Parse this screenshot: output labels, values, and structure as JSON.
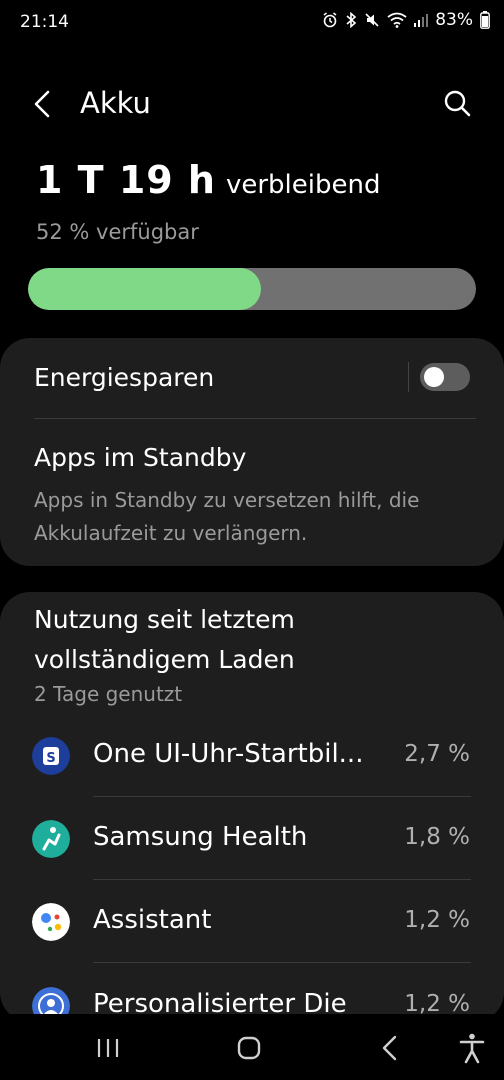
{
  "status_bar": {
    "time": "21:14",
    "battery_percent": "83%",
    "icons": [
      "alarm-icon",
      "bluetooth-icon",
      "mute-icon",
      "wifi-icon",
      "signal-icon"
    ]
  },
  "header": {
    "title": "Akku",
    "back_icon": "chevron-left-icon",
    "search_icon": "search-icon"
  },
  "battery": {
    "remaining_value": "1 T 19 h",
    "remaining_label": "verbleibend",
    "available": "52 % verfügbar",
    "level_fraction": 0.52,
    "fill_color": "#80d986"
  },
  "settings": {
    "power_saving_label": "Energiesparen",
    "power_saving_on": false,
    "standby_title": "Apps im Standby",
    "standby_desc": "Apps in Standby zu versetzen hilft, die Akkulaufzeit zu verlängern."
  },
  "usage": {
    "title": "Nutzung seit letztem vollständigem Laden",
    "subtitle": "2 Tage genutzt",
    "apps": [
      {
        "name": "One UI-Uhr-Startbil...",
        "percent": "2,7 %",
        "icon": "one-ui-watch-icon"
      },
      {
        "name": "Samsung Health",
        "percent": "1,8 %",
        "icon": "samsung-health-icon"
      },
      {
        "name": "Assistant",
        "percent": "1,2 %",
        "icon": "assistant-icon"
      },
      {
        "name": "Personalisierter Die",
        "percent": "1,2 %",
        "icon": "personalization-icon"
      }
    ]
  },
  "nav_bar": {
    "buttons": [
      "recents-icon",
      "home-icon",
      "back-icon",
      "accessibility-icon"
    ]
  }
}
